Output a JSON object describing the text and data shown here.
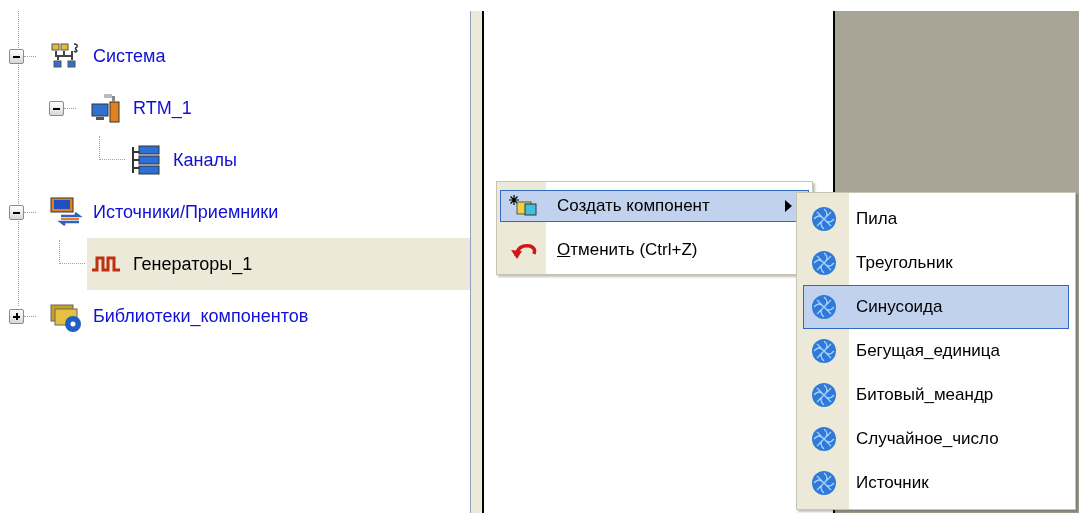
{
  "tree": [
    {
      "label": "Система",
      "kind": "system",
      "expanded": true,
      "selected": false,
      "children": [
        {
          "label": "RTM_1",
          "kind": "device",
          "expanded": true,
          "selected": false,
          "children": [
            {
              "label": "Каналы",
              "kind": "channels",
              "selected": false
            }
          ]
        }
      ]
    },
    {
      "label": "Источники/Приемники",
      "kind": "io",
      "expanded": true,
      "selected": false,
      "children": [
        {
          "label": "Генераторы_1",
          "kind": "generator",
          "selected": true
        }
      ]
    },
    {
      "label": "Библиотеки_компонентов",
      "kind": "library",
      "expanded": false,
      "selected": false
    }
  ],
  "context_menu": [
    {
      "label": "Создать компонент",
      "kind": "create",
      "selected": true,
      "submenu": true,
      "mnemonic": false
    },
    {
      "label": "Отменить (Ctrl+Z)",
      "kind": "undo",
      "selected": false,
      "submenu": false,
      "mnemonic": true
    }
  ],
  "submenu": [
    {
      "label": "Пила",
      "selected": false
    },
    {
      "label": "Треугольник",
      "selected": false
    },
    {
      "label": "Синусоида",
      "selected": true
    },
    {
      "label": "Бегущая_единица",
      "selected": false
    },
    {
      "label": "Битовый_меандр",
      "selected": false
    },
    {
      "label": "Случайное_число",
      "selected": false
    },
    {
      "label": "Источник",
      "selected": false
    }
  ]
}
